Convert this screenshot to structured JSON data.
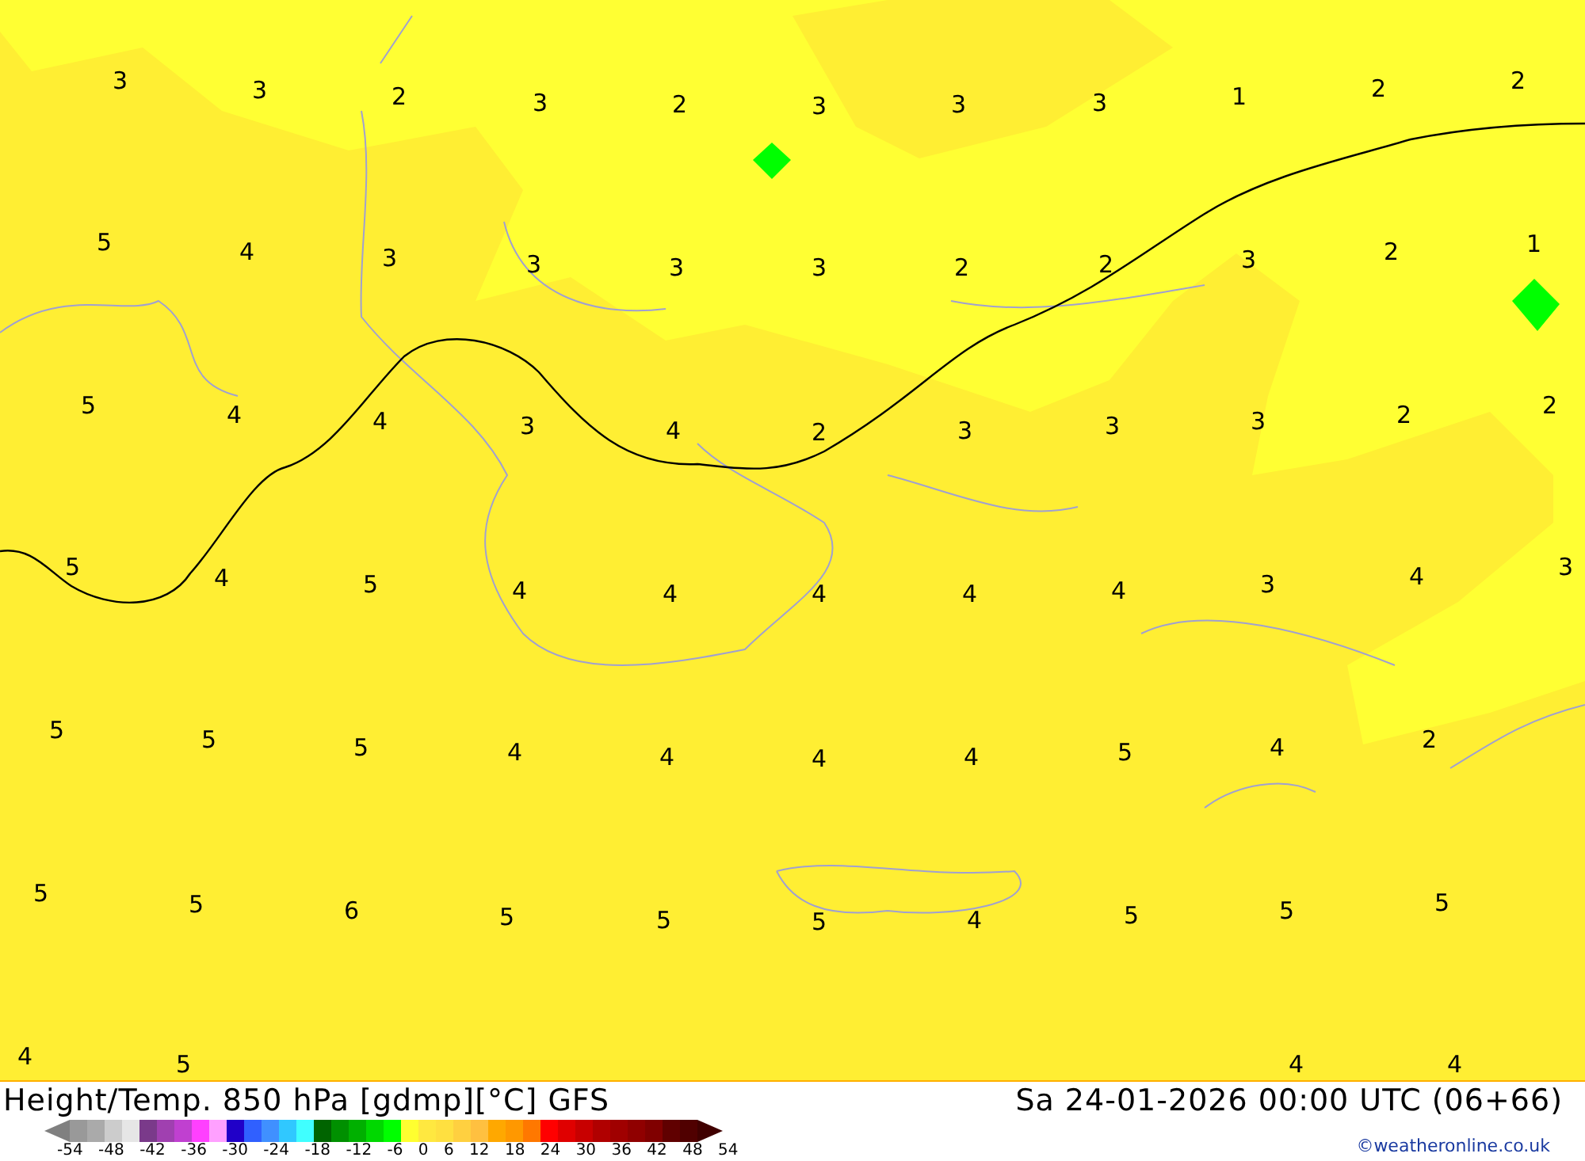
{
  "map": {
    "labels": [
      {
        "value": "3"
      },
      {
        "value": "3"
      },
      {
        "value": "2"
      },
      {
        "value": "3"
      },
      {
        "value": "2"
      },
      {
        "value": "3"
      },
      {
        "value": "3"
      },
      {
        "value": "3"
      },
      {
        "value": "1"
      },
      {
        "value": "2"
      },
      {
        "value": "2"
      },
      {
        "value": "5"
      },
      {
        "value": "4"
      },
      {
        "value": "3"
      },
      {
        "value": "3"
      },
      {
        "value": "3"
      },
      {
        "value": "3"
      },
      {
        "value": "2"
      },
      {
        "value": "2"
      },
      {
        "value": "3"
      },
      {
        "value": "2"
      },
      {
        "value": "1"
      },
      {
        "value": "5"
      },
      {
        "value": "4"
      },
      {
        "value": "4"
      },
      {
        "value": "3"
      },
      {
        "value": "4"
      },
      {
        "value": "2"
      },
      {
        "value": "3"
      },
      {
        "value": "3"
      },
      {
        "value": "3"
      },
      {
        "value": "2"
      },
      {
        "value": "2"
      },
      {
        "value": "5"
      },
      {
        "value": "4"
      },
      {
        "value": "5"
      },
      {
        "value": "4"
      },
      {
        "value": "4"
      },
      {
        "value": "4"
      },
      {
        "value": "4"
      },
      {
        "value": "4"
      },
      {
        "value": "3"
      },
      {
        "value": "4"
      },
      {
        "value": "3"
      },
      {
        "value": "5"
      },
      {
        "value": "5"
      },
      {
        "value": "5"
      },
      {
        "value": "4"
      },
      {
        "value": "4"
      },
      {
        "value": "4"
      },
      {
        "value": "4"
      },
      {
        "value": "5"
      },
      {
        "value": "4"
      },
      {
        "value": "2"
      },
      {
        "value": "5"
      },
      {
        "value": "5"
      },
      {
        "value": "6"
      },
      {
        "value": "5"
      },
      {
        "value": "5"
      },
      {
        "value": "5"
      },
      {
        "value": "4"
      },
      {
        "value": "5"
      },
      {
        "value": "5"
      },
      {
        "value": "5"
      },
      {
        "value": "4"
      },
      {
        "value": "5"
      },
      {
        "value": "4"
      },
      {
        "value": "4"
      }
    ]
  },
  "title": "Height/Temp. 850 hPa [gdmp][°C] GFS",
  "datetime": "Sa 24-01-2026 00:00 UTC (06+66)",
  "legend": {
    "swatches": [
      {
        "color": "#999999"
      },
      {
        "color": "#aaaaaa"
      },
      {
        "color": "#cccccc"
      },
      {
        "color": "#e6e6e6"
      },
      {
        "color": "#7a3a8a"
      },
      {
        "color": "#a040b0"
      },
      {
        "color": "#c040d0"
      },
      {
        "color": "#ff40ff"
      },
      {
        "color": "#ffa0ff"
      },
      {
        "color": "#2000c8"
      },
      {
        "color": "#3060ff"
      },
      {
        "color": "#4090ff"
      },
      {
        "color": "#30c8ff"
      },
      {
        "color": "#40ffff"
      },
      {
        "color": "#006400"
      },
      {
        "color": "#009000"
      },
      {
        "color": "#00b000"
      },
      {
        "color": "#00d800"
      },
      {
        "color": "#00ff00"
      },
      {
        "color": "#ffff30"
      },
      {
        "color": "#ffe840"
      },
      {
        "color": "#ffe040"
      },
      {
        "color": "#ffd040"
      },
      {
        "color": "#ffc040"
      },
      {
        "color": "#ffa800"
      },
      {
        "color": "#ff9800"
      },
      {
        "color": "#ff7800"
      },
      {
        "color": "#ff0000"
      },
      {
        "color": "#e00000"
      },
      {
        "color": "#c80000"
      },
      {
        "color": "#b00000"
      },
      {
        "color": "#a00000"
      },
      {
        "color": "#900000"
      },
      {
        "color": "#800000"
      },
      {
        "color": "#600000"
      },
      {
        "color": "#500000"
      }
    ],
    "ticks": [
      "-54",
      "-48",
      "-42",
      "-36",
      "-30",
      "-24",
      "-18",
      "-12",
      "-6",
      "0",
      "6",
      "12",
      "18",
      "24",
      "30",
      "36",
      "42",
      "48",
      "54"
    ]
  },
  "credit": "©weatheronline.co.uk"
}
